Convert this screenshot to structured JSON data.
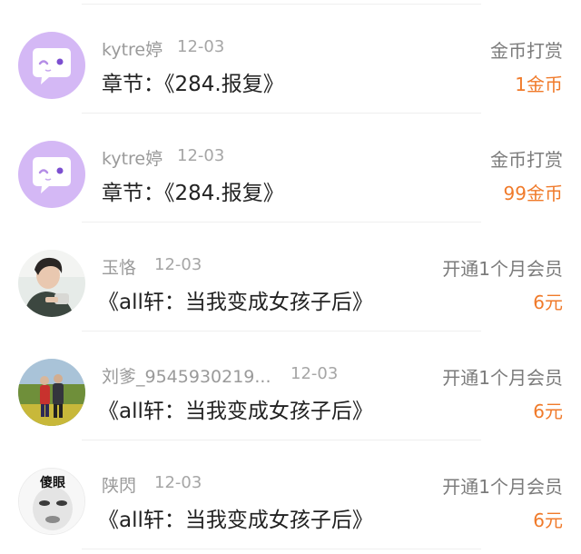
{
  "records": [
    {
      "user": "kytre婷",
      "date": "12-03",
      "title": "章节：《284.报复》",
      "type": "金币打赏",
      "amount": "1金币",
      "avatar_icon": "chat-bubble-icon"
    },
    {
      "user": "kytre婷",
      "date": "12-03",
      "title": "章节：《284.报复》",
      "type": "金币打赏",
      "amount": "99金币",
      "avatar_icon": "chat-bubble-icon"
    },
    {
      "user": "玉恪",
      "date": "12-03",
      "title": "《all轩：当我变成女孩子后》",
      "type": "开通1个月会员",
      "amount": "6元",
      "avatar_icon": "user-photo"
    },
    {
      "user": "刘爹_9545930219...",
      "date": "12-03",
      "title": "《all轩：当我变成女孩子后》",
      "type": "开通1个月会员",
      "amount": "6元",
      "avatar_icon": "user-photo"
    },
    {
      "user": "陕閃",
      "date": "12-03",
      "title": "《all轩：当我变成女孩子后》",
      "type": "开通1个月会员",
      "amount": "6元",
      "avatar_icon": "meme-face"
    }
  ],
  "avatar_meme_text": "傻眼",
  "colors": {
    "amount": "#f07a2a",
    "default_avatar": "#d4b8f5"
  }
}
